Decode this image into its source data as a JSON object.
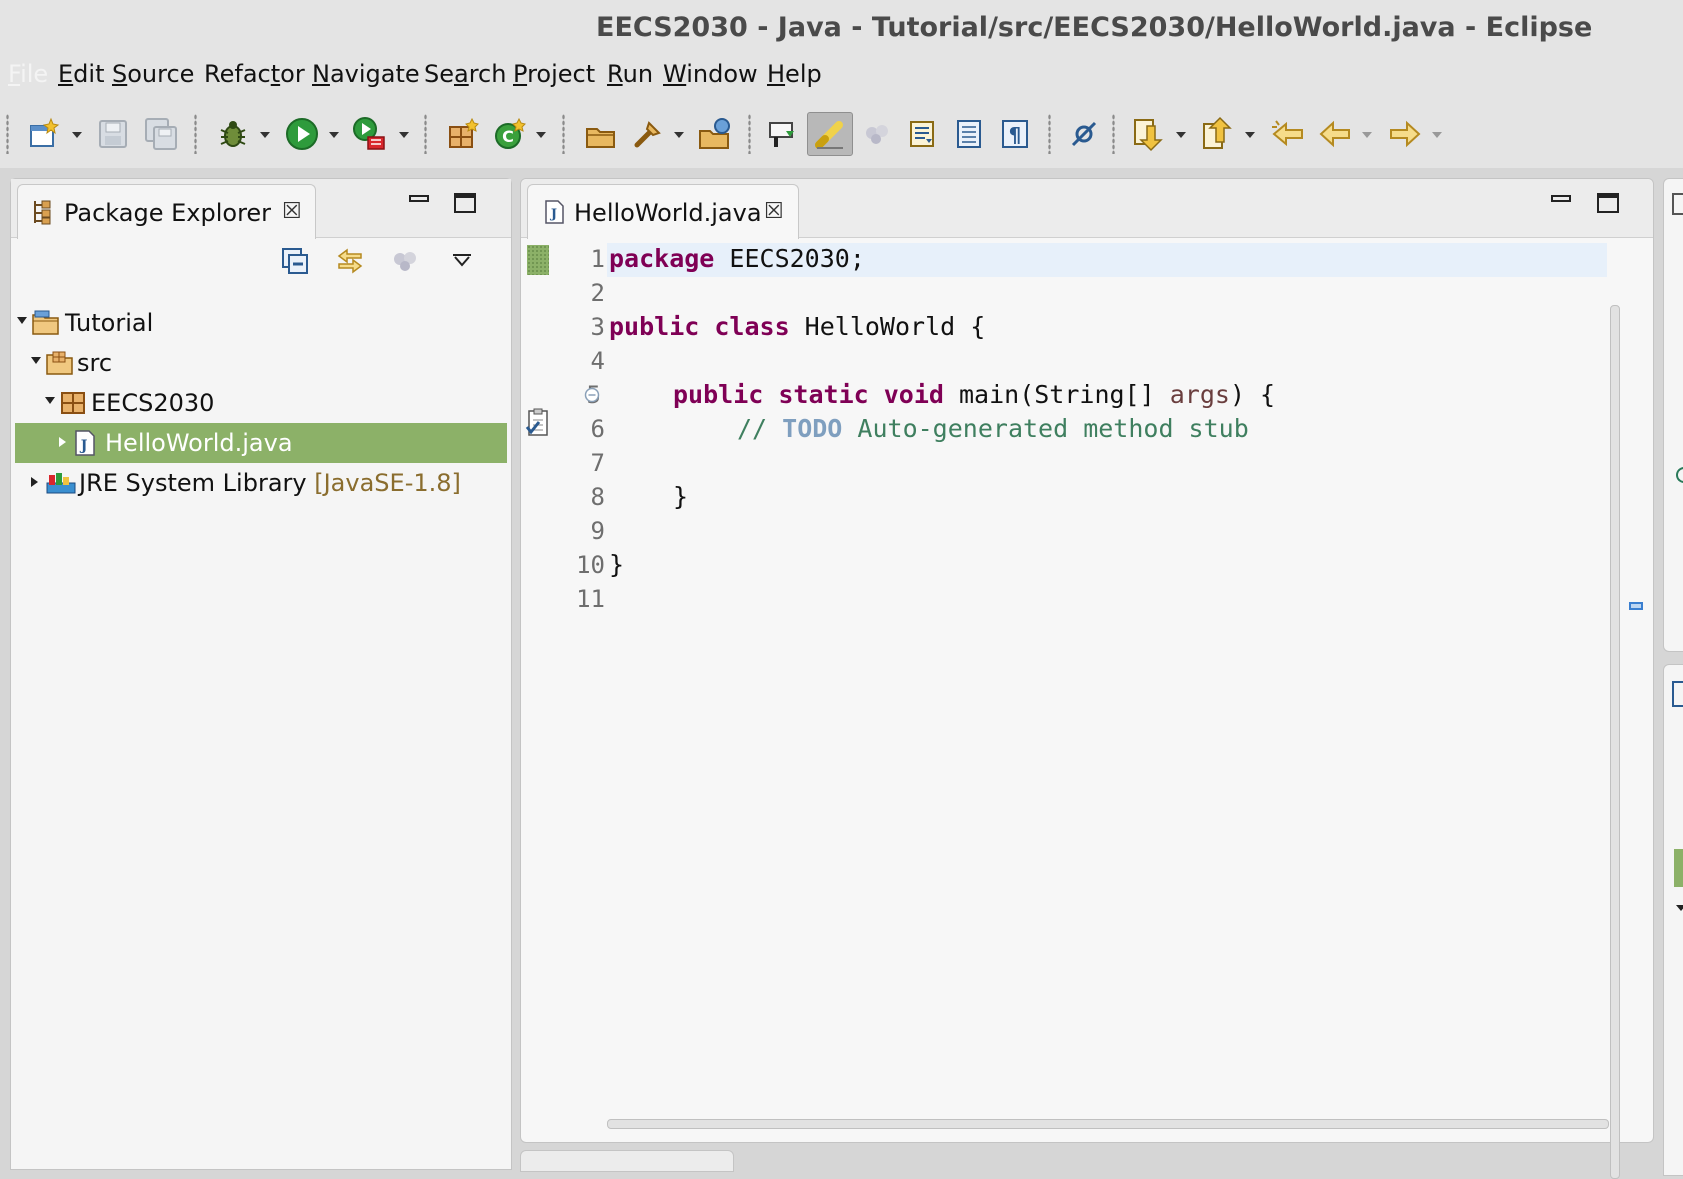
{
  "window": {
    "title": "EECS2030 - Java - Tutorial/src/EECS2030/HelloWorld.java - Eclipse"
  },
  "menu": [
    {
      "pre": "",
      "mn": "F",
      "post": "ile",
      "disabled": true
    },
    {
      "pre": "",
      "mn": "E",
      "post": "dit"
    },
    {
      "pre": "",
      "mn": "S",
      "post": "ource"
    },
    {
      "pre": "Refac",
      "mn": "t",
      "post": "or"
    },
    {
      "pre": "",
      "mn": "N",
      "post": "avigate"
    },
    {
      "pre": "Se",
      "mn": "a",
      "post": "rch"
    },
    {
      "pre": "",
      "mn": "P",
      "post": "roject"
    },
    {
      "pre": "",
      "mn": "R",
      "post": "un"
    },
    {
      "pre": "",
      "mn": "W",
      "post": "indow"
    },
    {
      "pre": "",
      "mn": "H",
      "post": "elp"
    }
  ],
  "toolbar": {
    "icons": [
      "new-wizard-icon",
      "save-icon",
      "save-all-icon",
      "debug-icon",
      "run-icon",
      "run-external-tool-icon",
      "new-java-package-icon",
      "new-java-class-icon",
      "open-type-icon",
      "open-task-icon",
      "search-icon",
      "toggle-breadcrumb-icon",
      "mark-occurrences-icon",
      "toggle-highlight-icon",
      "toggle-block-selection-icon",
      "show-whitespace-icon",
      "pilcrow-icon",
      "skip-breakpoints-icon",
      "next-annotation-icon",
      "previous-annotation-icon",
      "last-edit-location-icon",
      "back-icon",
      "forward-icon"
    ]
  },
  "package_explorer": {
    "tab_label": "Package Explorer",
    "tree": [
      {
        "label": "Tutorial",
        "expanded": true,
        "icon": "project-folder-icon"
      },
      {
        "label": "src",
        "expanded": true,
        "icon": "source-folder-icon"
      },
      {
        "label": "EECS2030",
        "expanded": true,
        "icon": "package-icon"
      },
      {
        "label": "HelloWorld.java",
        "expanded": false,
        "selected": true,
        "icon": "java-file-icon"
      },
      {
        "label": "JRE System Library",
        "decoration": "[JavaSE-1.8]",
        "expanded": false,
        "icon": "library-icon"
      }
    ]
  },
  "editor": {
    "tab_label": "HelloWorld.java",
    "line_numbers": [
      "1",
      "2",
      "3",
      "4",
      "5",
      "6",
      "7",
      "8",
      "9",
      "10",
      "11"
    ],
    "code": {
      "l1_kw": "package",
      "l1_rest": " EECS2030;",
      "l3_kw": "public class",
      "l3_rest": " HelloWorld {",
      "l5_kw": "public static void",
      "l5_mid": " main(String[] ",
      "l5_param": "args",
      "l5_end": ") {",
      "l6_slashes": "// ",
      "l6_todo": "TODO",
      "l6_rest": " Auto-generated method stub",
      "l8": "}",
      "l10": "}"
    }
  },
  "colors": {
    "keyword": "#7f0055",
    "comment": "#3f7f5f",
    "todo": "#7f9fbf",
    "selection": "#8cb168",
    "current_line": "#e7f0fa"
  }
}
